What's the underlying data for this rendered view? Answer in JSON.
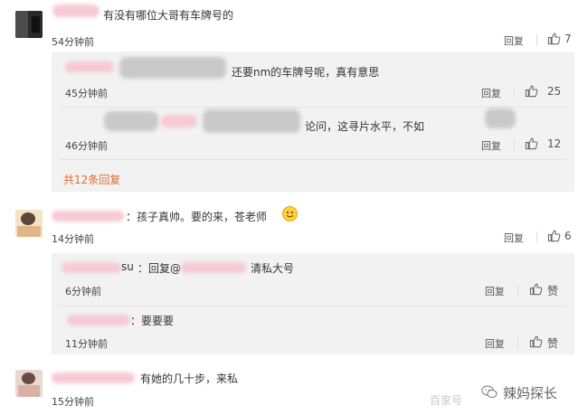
{
  "comments": [
    {
      "text": "有没有哪位大哥有车牌号的",
      "time": "54分钟前",
      "reply_label": "回复",
      "likes": "7",
      "replies": [
        {
          "text": "还要nm的车牌号呢，真有意思",
          "time": "45分钟前",
          "reply_label": "回复",
          "likes": "25"
        },
        {
          "text": "论问，这寻片水平，不如",
          "time": "46分钟前",
          "reply_label": "回复",
          "likes": "12"
        }
      ],
      "more_replies": "共12条回复"
    },
    {
      "text": "：孩子真帅。要的来，苍老师",
      "time": "14分钟前",
      "reply_label": "回复",
      "likes": "6",
      "replies": [
        {
          "name_suffix": "su",
          "reply_prefix": "：回复@",
          "text": "清私大号",
          "time": "6分钟前",
          "reply_label": "回复",
          "likes": "赞"
        },
        {
          "text": "：要要要",
          "time": "11分钟前",
          "reply_label": "回复",
          "likes": "赞"
        }
      ]
    },
    {
      "text": "有她的几十步，来私",
      "time": "15分钟前"
    }
  ],
  "watermark": {
    "baidu": "百家号",
    "account": "辣妈探长"
  },
  "colors": {
    "more_link": "#e06b2d",
    "panel_bg": "#f2f2f2",
    "text": "#333333"
  },
  "icons": [
    "thumbs-up-icon",
    "smiley-emoji-icon",
    "wechat-icon"
  ]
}
